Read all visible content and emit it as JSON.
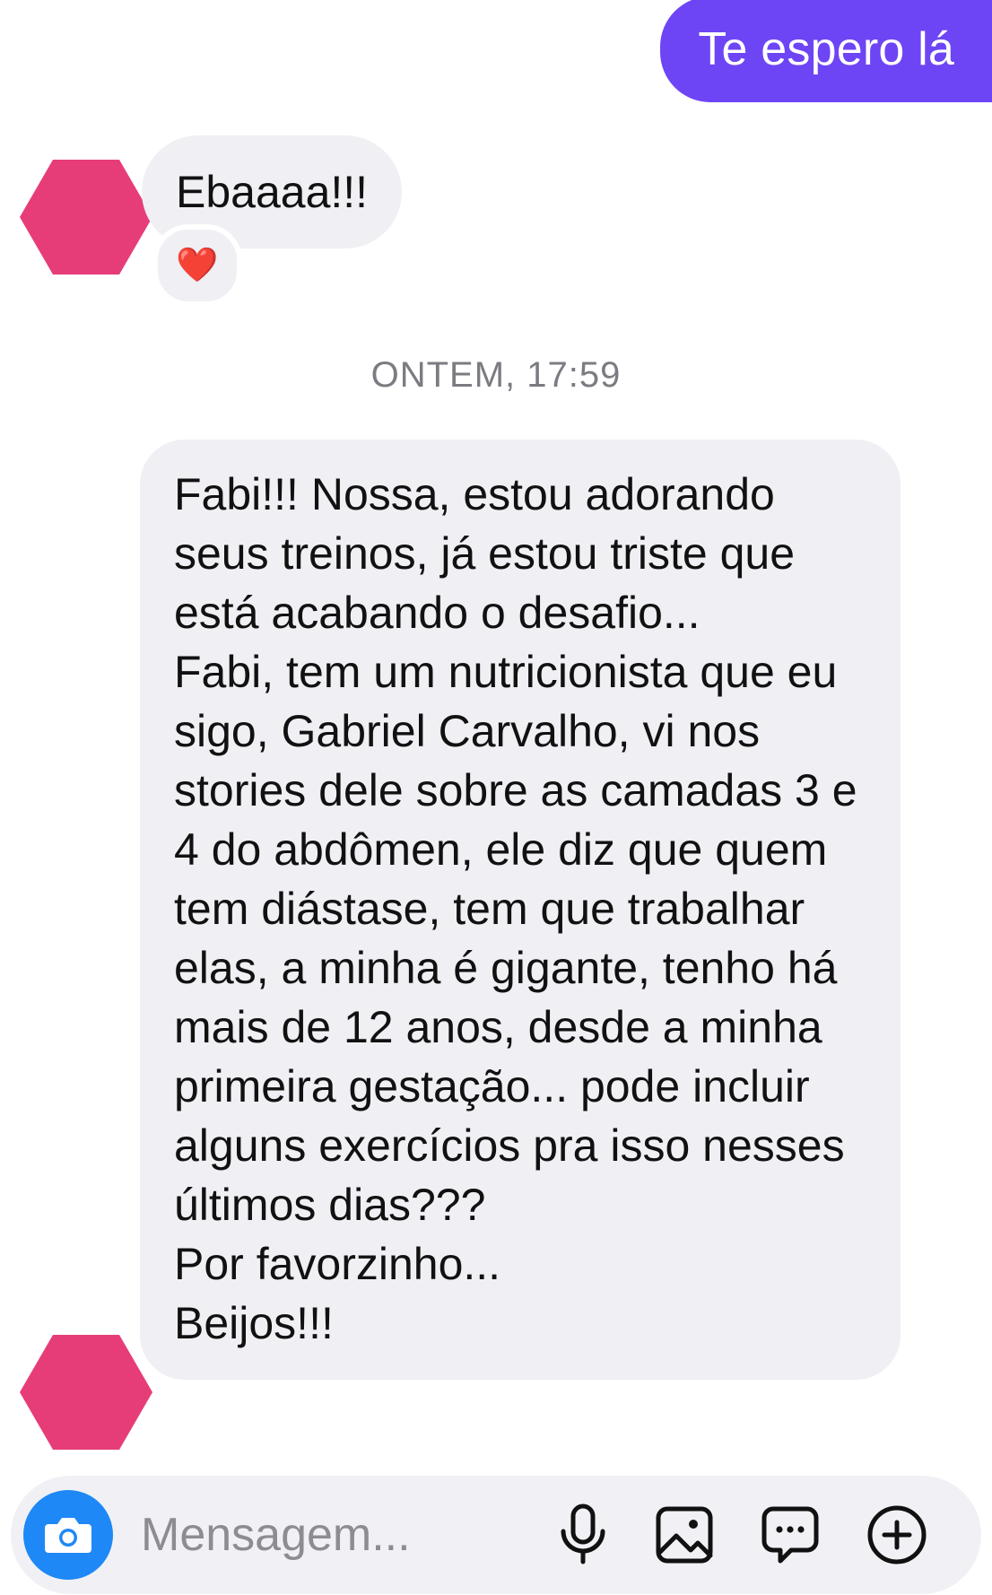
{
  "conversation": {
    "sent_message": "Te espero lá",
    "received_short": {
      "text": "Ebaaaa!!!",
      "reaction": "❤️"
    },
    "timestamp": "ONTEM, 17:59",
    "received_long": {
      "text": "Fabi!!! Nossa,  estou adorando seus treinos,  já estou triste que está acabando o desafio...\nFabi, tem um nutricionista que eu sigo,  Gabriel Carvalho, vi nos stories dele sobre as camadas 3 e 4 do abdômen, ele diz que quem tem diástase, tem que trabalhar elas, a minha é gigante, tenho há mais de 12 anos,  desde a minha primeira gestação... pode incluir alguns exercícios pra isso nesses últimos dias???\nPor favorzinho...\nBeijos!!!"
    }
  },
  "composer": {
    "placeholder": "Mensagem...",
    "icons": [
      "camera-icon",
      "microphone-icon",
      "gallery-icon",
      "sticker-icon",
      "add-icon"
    ]
  },
  "colors": {
    "sent_bubble": "#6d45f5",
    "received_bubble": "#efeff4",
    "camera_button": "#1e88f6",
    "avatar_redaction": "#e63d79"
  }
}
